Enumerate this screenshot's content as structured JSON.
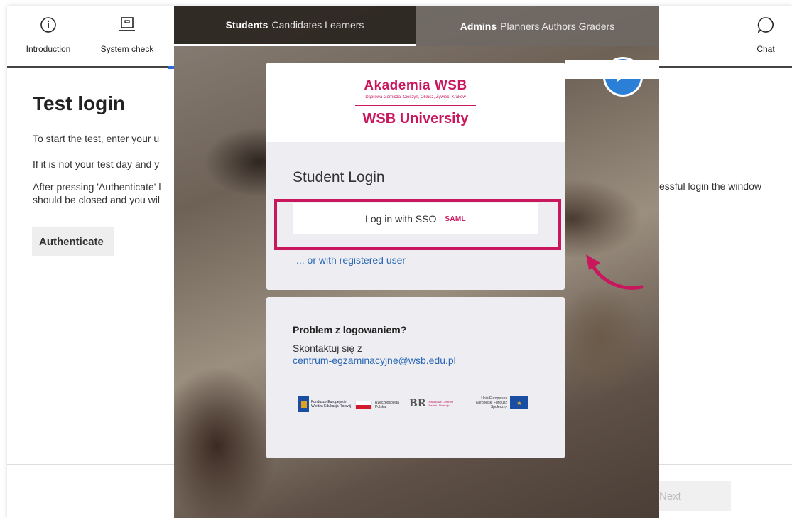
{
  "nav": {
    "introduction": "Introduction",
    "system_check": "System check",
    "chat": "Chat"
  },
  "test_page": {
    "title": "Test login",
    "para1": "To start the test, enter your u",
    "para2": "If it is not your test day and y",
    "para3": "After pressing 'Authenticate' l should be closed and you wil",
    "para3_right": "essful login the window",
    "authenticate_label": "Authenticate",
    "next_label": "Next"
  },
  "overlay": {
    "tabs": [
      {
        "bold": "Students",
        "sub": "Candidates Learners"
      },
      {
        "bold": "Admins",
        "sub": "Planners Authors Graders"
      }
    ],
    "logo": {
      "top": "Akademia WSB",
      "cities": "Dąbrowa Górnicza, Cieszyn, Olkusz, Żywiec, Kraków",
      "main": "WSB University"
    },
    "login_heading": "Student Login",
    "sso_label": "Log in with SSO",
    "saml_label": "SAML",
    "registered_link": "... or with registered user",
    "help_title": "Problem z logowaniem?",
    "help_text": "Skontaktuj się z",
    "help_email": "centrum-egzaminacyjne@wsb.edu.pl",
    "funding_logos": {
      "fe": "Fundusze Europejskie Wiedza Edukacja Rozwój",
      "pl": "Rzeczpospolita Polska",
      "br": "Narodowe Centrum Badań i Rozwoju",
      "ue": "Unia Europejska Europejski Fundusz Społeczny"
    }
  },
  "colors": {
    "brand": "#c8175d",
    "link": "#2a67b5",
    "chat_bubble": "#2b7fd6"
  }
}
